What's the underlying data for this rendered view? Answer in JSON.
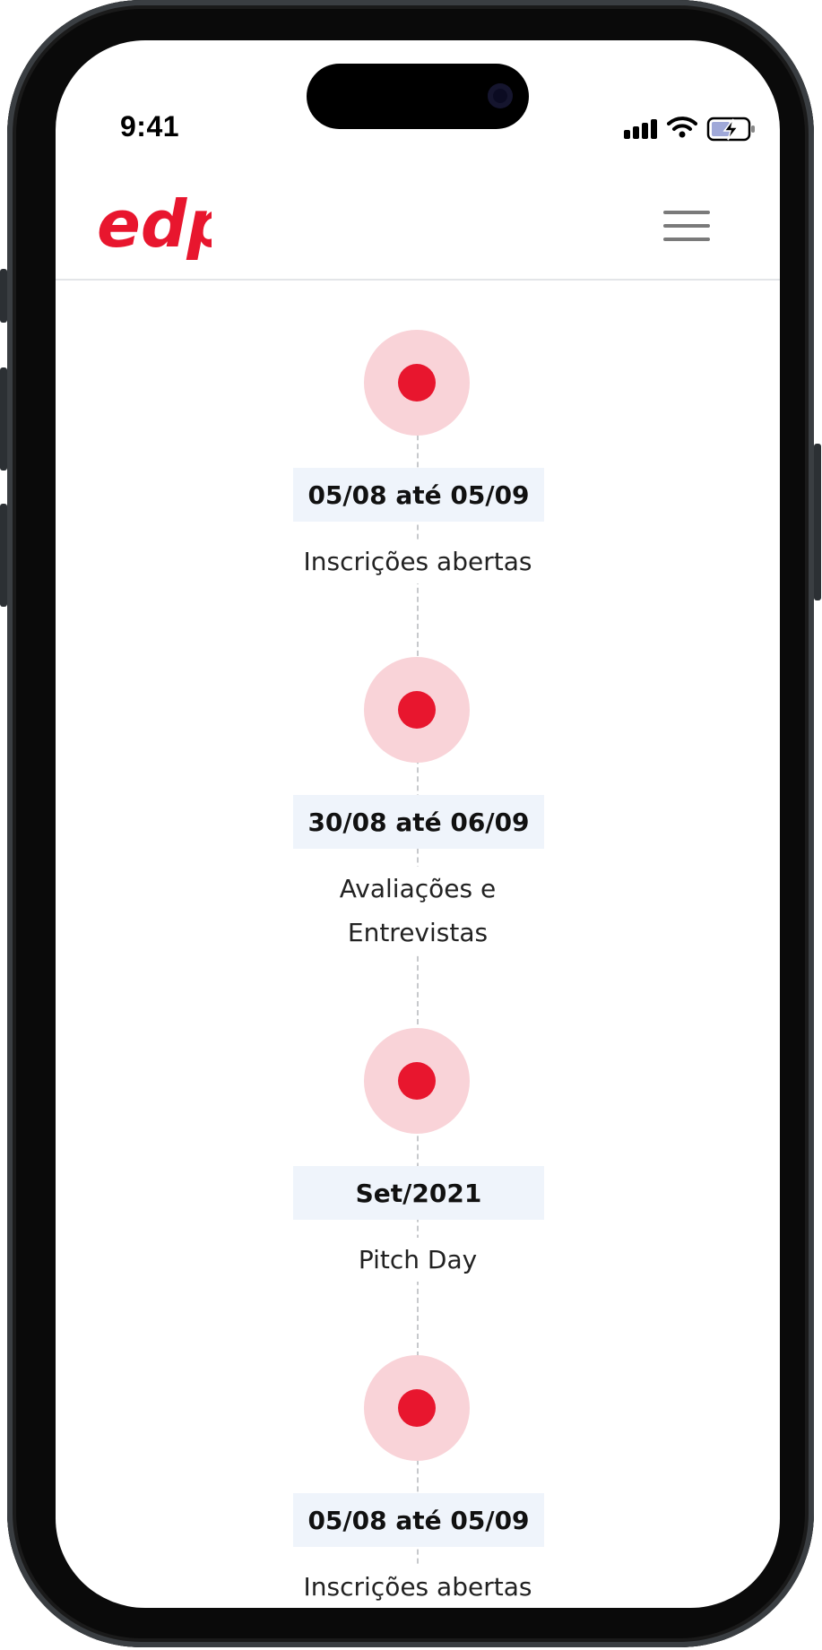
{
  "status_bar": {
    "time": "9:41"
  },
  "header": {
    "logo_text": "edp",
    "brand_color": "#E8162E"
  },
  "timeline": {
    "items": [
      {
        "date": "05/08 até 05/09",
        "label": "Inscrições abertas"
      },
      {
        "date": "30/08 até 06/09",
        "label": "Avaliações e Entrevistas"
      },
      {
        "date": "Set/2021",
        "label": "Pitch Day"
      },
      {
        "date": "05/08 até 05/09",
        "label": "Inscrições abertas"
      }
    ]
  },
  "colors": {
    "dot": "#E8162E",
    "dot_halo": "#F9D3D8",
    "date_bg": "#EFF4FB",
    "line": "#C7C9CC"
  },
  "icons": [
    "signal-icon",
    "wifi-icon",
    "battery-charging-icon",
    "hamburger-menu-icon"
  ]
}
